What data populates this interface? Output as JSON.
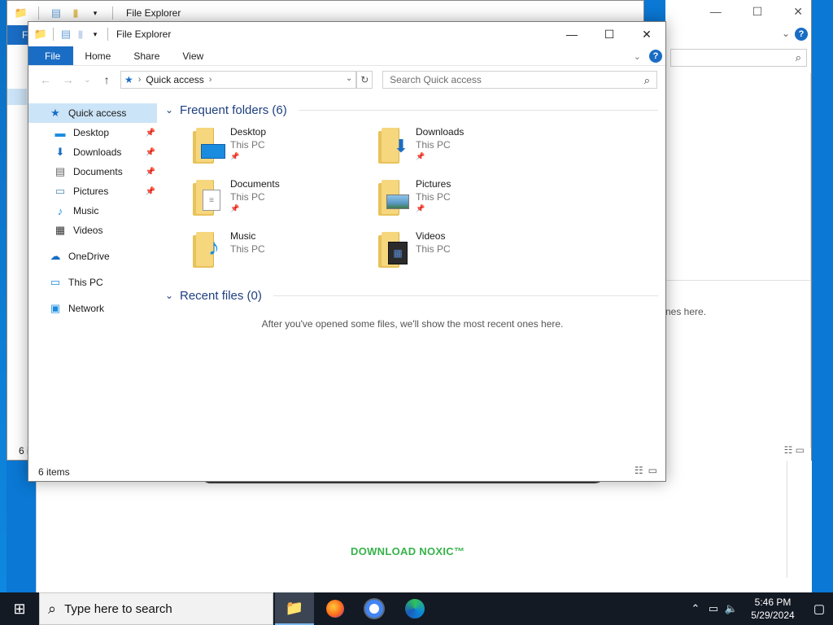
{
  "background_window": {
    "title": "File Explorer",
    "file_tab": "F",
    "status": "6 i",
    "recent_tail": "nes here."
  },
  "web_page": {
    "download_label": "DOWNLOAD NOXIC™"
  },
  "window": {
    "title": "File Explorer",
    "tabs": [
      "File",
      "Home",
      "Share",
      "View"
    ],
    "help": "?",
    "address": {
      "location": "Quick access"
    },
    "search": {
      "placeholder": "Search Quick access"
    },
    "nav": {
      "quick_access": "Quick access",
      "items": [
        {
          "label": "Desktop",
          "icon": "desktop-icon",
          "pinned": true
        },
        {
          "label": "Downloads",
          "icon": "downloads-icon",
          "pinned": true
        },
        {
          "label": "Documents",
          "icon": "documents-icon",
          "pinned": true
        },
        {
          "label": "Pictures",
          "icon": "pictures-icon",
          "pinned": true
        },
        {
          "label": "Music",
          "icon": "music-icon",
          "pinned": false
        },
        {
          "label": "Videos",
          "icon": "videos-icon",
          "pinned": false
        }
      ],
      "onedrive": "OneDrive",
      "this_pc": "This PC",
      "network": "Network"
    },
    "frequent": {
      "header": "Frequent folders (6)",
      "folders": [
        {
          "name": "Desktop",
          "location": "This PC",
          "pinned": true
        },
        {
          "name": "Downloads",
          "location": "This PC",
          "pinned": true
        },
        {
          "name": "Documents",
          "location": "This PC",
          "pinned": true
        },
        {
          "name": "Pictures",
          "location": "This PC",
          "pinned": true
        },
        {
          "name": "Music",
          "location": "This PC",
          "pinned": false
        },
        {
          "name": "Videos",
          "location": "This PC",
          "pinned": false
        }
      ]
    },
    "recent": {
      "header": "Recent files (0)",
      "empty": "After you've opened some files, we'll show the most recent ones here."
    },
    "status": "6 items"
  },
  "taskbar": {
    "search_placeholder": "Type here to search",
    "time": "5:46 PM",
    "date": "5/29/2024"
  },
  "colors": {
    "accent": "#1a6dc5",
    "selection": "#cce4f7",
    "header_text": "#1e3f80",
    "taskbar": "#131a24",
    "download_green": "#36b24a"
  }
}
